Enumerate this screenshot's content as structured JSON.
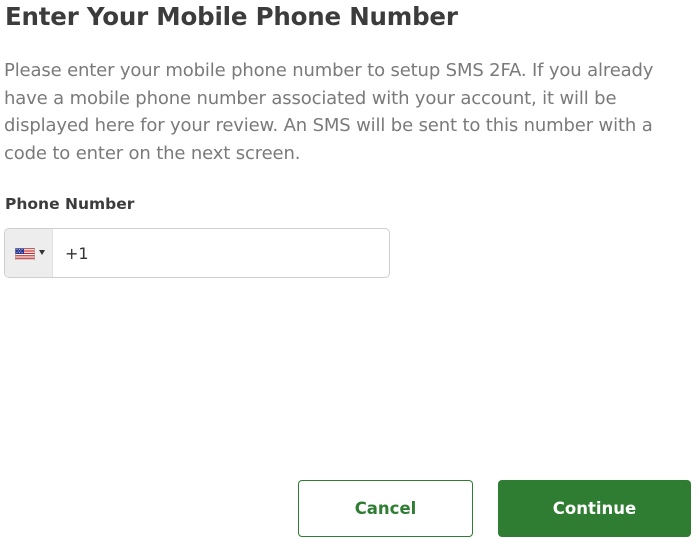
{
  "dialog": {
    "title": "Enter Your Mobile Phone Number",
    "description": "Please enter your mobile phone number to setup SMS 2FA. If you already have a mobile phone number associated with your account, it will be displayed here for your review. An SMS will be sent to this number with a code to enter on the next screen."
  },
  "phone_field": {
    "label": "Phone Number",
    "value": "+1",
    "country_flag_icon": "us-flag-icon"
  },
  "actions": {
    "cancel_label": "Cancel",
    "continue_label": "Continue"
  },
  "colors": {
    "accent": "#2e7d32",
    "text": "#3c3c3c",
    "muted_text": "#7a7a7a",
    "input_border": "#cfcfcf"
  }
}
